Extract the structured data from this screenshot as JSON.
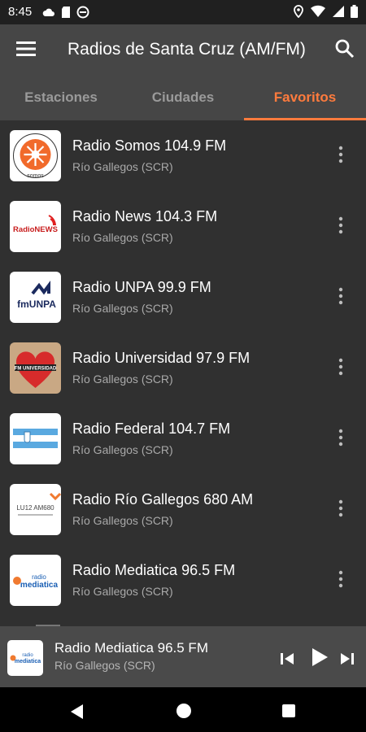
{
  "status_bar": {
    "time": "8:45",
    "icons_left": [
      "cloud-icon",
      "sd-card-icon",
      "no-disturb-icon"
    ],
    "icons_right": [
      "location-icon",
      "wifi-icon",
      "signal-icon",
      "battery-icon"
    ]
  },
  "app_bar": {
    "title": "Radios de Santa Cruz (AM/FM)",
    "menu_icon": "menu-icon",
    "search_icon": "search-icon"
  },
  "tabs": [
    {
      "label": "Estaciones",
      "active": false
    },
    {
      "label": "Ciudades",
      "active": false
    },
    {
      "label": "Favoritos",
      "active": true
    }
  ],
  "stations": [
    {
      "name": "Radio Somos 104.9 FM",
      "city": "Río Gallegos (SCR)",
      "logo": "radio-somos-logo",
      "logo_text": "somos"
    },
    {
      "name": "Radio News 104.3 FM",
      "city": "Río Gallegos (SCR)",
      "logo": "radio-news-logo",
      "logo_text": "RadioNEWS"
    },
    {
      "name": "Radio UNPA 99.9 FM",
      "city": "Río Gallegos (SCR)",
      "logo": "radio-unpa-logo",
      "logo_text": "fmUNPA"
    },
    {
      "name": "Radio Universidad 97.9 FM",
      "city": "Río Gallegos (SCR)",
      "logo": "radio-universidad-logo",
      "logo_text": "FM UNIVERSIDAD"
    },
    {
      "name": "Radio Federal 104.7 FM",
      "city": "Río Gallegos (SCR)",
      "logo": "radio-federal-logo",
      "logo_text": ""
    },
    {
      "name": "Radio Río Gallegos 680 AM",
      "city": "Río Gallegos (SCR)",
      "logo": "radio-rio-gallegos-logo",
      "logo_text": "LU12 AM680"
    },
    {
      "name": "Radio Mediatica 96.5 FM",
      "city": "Río Gallegos (SCR)",
      "logo": "radio-mediatica-logo",
      "logo_text": "radio mediatica"
    }
  ],
  "now_playing": {
    "name": "Radio Mediatica 96.5 FM",
    "city": "Río Gallegos (SCR)"
  },
  "colors": {
    "accent": "#ff7b3d",
    "app_bar": "#464646",
    "background": "#303030",
    "player_bar": "#4a4a4a"
  }
}
